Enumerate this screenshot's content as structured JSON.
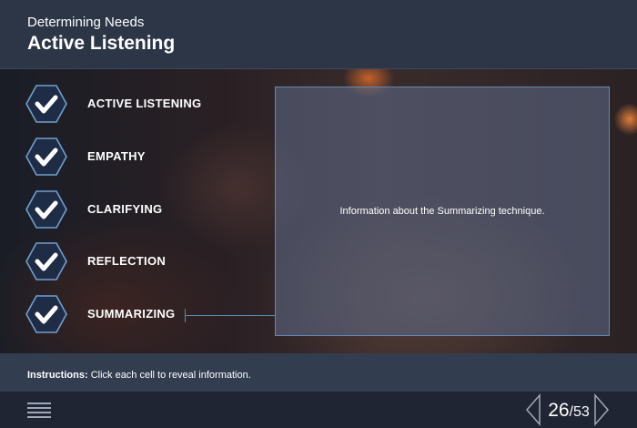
{
  "header": {
    "subtitle": "Determining Needs",
    "title": "Active Listening"
  },
  "items": [
    {
      "label": "ACTIVE LISTENING",
      "icon": "check-icon",
      "completed": true
    },
    {
      "label": "EMPATHY",
      "icon": "check-icon",
      "completed": true
    },
    {
      "label": "CLARIFYING",
      "icon": "check-icon",
      "completed": true
    },
    {
      "label": "REFLECTION",
      "icon": "check-icon",
      "completed": true
    },
    {
      "label": "SUMMARIZING",
      "icon": "check-icon",
      "completed": true,
      "selected": true
    }
  ],
  "panel": {
    "text": "Information about the Summarizing technique."
  },
  "instructions": {
    "label": "Instructions:",
    "text": "Click each cell to reveal information."
  },
  "footer": {
    "menu_icon": "hamburger-menu-icon",
    "prev_icon": "chevron-left-icon",
    "next_icon": "chevron-right-icon",
    "current_page": "26",
    "separator": "/",
    "total_pages": "53"
  },
  "colors": {
    "header_bg": "#2c3647",
    "accent": "#5a8cb8",
    "hex_fill": "#1f2c45",
    "hex_stroke": "#6fa0d0"
  }
}
